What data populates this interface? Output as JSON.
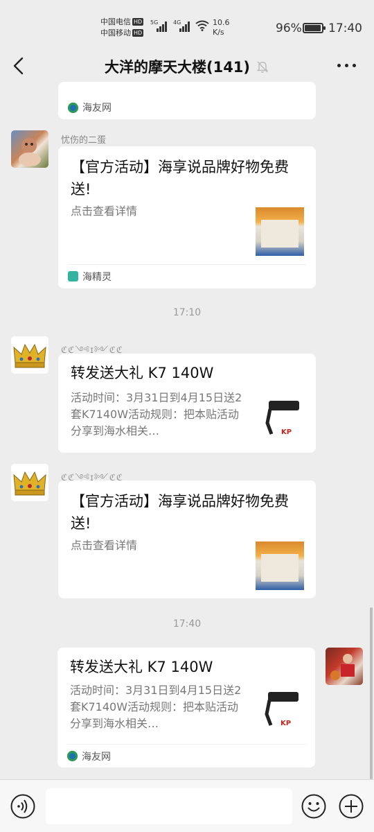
{
  "status_bar": {
    "carrier1": "中国电信",
    "carrier2": "中国移动",
    "hd": "HD",
    "sig1": "5G",
    "sig2": "4G",
    "speed_value": "10.6",
    "speed_unit": "K/s",
    "battery_pct": "96%",
    "battery_level": 0.96,
    "time": "17:40"
  },
  "nav": {
    "title": "大洋的摩天大楼(141)",
    "icons": [
      "back-arrow-icon",
      "muted-bell-icon",
      "more-dots-icon"
    ]
  },
  "messages": {
    "m0": {
      "source": "海友网"
    },
    "m1": {
      "sender": "忧伤的二蛋",
      "title": "【官方活动】海享说品牌好物免费送!",
      "desc": "点击查看详情",
      "source": "海精灵"
    },
    "time1": "17:10",
    "m2": {
      "sender": "ℭℭ༺ɪ༻ℭℭ",
      "title": "转发送大礼 K7 140W",
      "desc": "活动时间：3月31日到4月15日送2套K7140W活动规则：把本贴活动分享到海水相关…"
    },
    "m3": {
      "sender": "ℭℭ༺ɪ༻ℭℭ",
      "title": "【官方活动】海享说品牌好物免费送!",
      "desc": "点击查看详情"
    },
    "time2": "17:40",
    "m4": {
      "title": "转发送大礼 K7 140W",
      "desc": "活动时间：3月31日到4月15日送2套K7140W活动规则：把本贴活动分享到海水相关…",
      "source": "海友网"
    }
  },
  "thumb_brand": "KP",
  "input": {
    "placeholder": ""
  },
  "colors": {
    "background": "#ededed",
    "card": "#ffffff",
    "accent_blue": "#1f5aa6"
  }
}
